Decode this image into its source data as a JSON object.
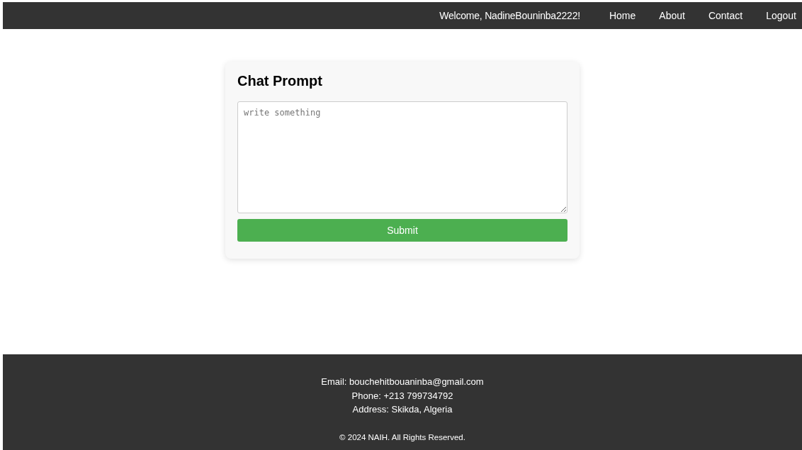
{
  "navbar": {
    "welcome": "Welcome, NadineBouninba2222!",
    "links": [
      "Home",
      "About",
      "Contact",
      "Logout"
    ]
  },
  "card": {
    "title": "Chat Prompt",
    "prompt": {
      "placeholder": "write something"
    },
    "submit": "Submit"
  },
  "footer": {
    "lines": [
      "Email: bouchehitbouaninba@gmail.com",
      "Phone: +213 799734792",
      "Address: Skikda, Algeria"
    ],
    "copyright": "© 2024 NAIH. All Rights Reserved."
  }
}
